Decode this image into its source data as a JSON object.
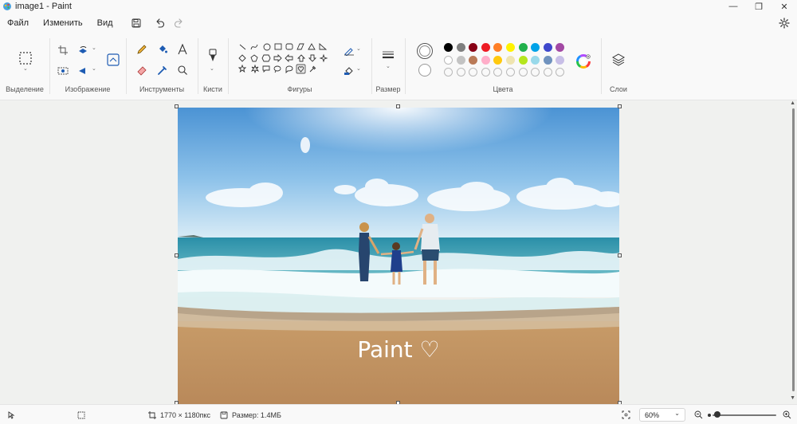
{
  "window": {
    "title": "image1 - Paint",
    "minimize": "—",
    "maximize": "❐",
    "close": "✕"
  },
  "menu": {
    "items": [
      "Файл",
      "Изменить",
      "Вид"
    ]
  },
  "ribbon": {
    "groups": {
      "selection": "Выделение",
      "image": "Изображение",
      "tools": "Инструменты",
      "brushes": "Кисти",
      "shapes": "Фигуры",
      "size": "Размер",
      "colors": "Цвета",
      "layers": "Слои"
    },
    "palette_row1": [
      "#000000",
      "#7f7f7f",
      "#880015",
      "#ed1c24",
      "#ff7f27",
      "#fff200",
      "#22b14c",
      "#00a2e8",
      "#3f48cc",
      "#a349a4"
    ],
    "palette_row2": [
      "#ffffff",
      "#c3c3c3",
      "#b97a57",
      "#ffaec9",
      "#ffc90e",
      "#efe4b0",
      "#b5e61d",
      "#99d9ea",
      "#7092be",
      "#c8bfe7"
    ],
    "palette_row3_empty": 10
  },
  "canvas": {
    "overlay_text": "Paint ♡",
    "accent": "#0067c0"
  },
  "status": {
    "dimensions": "1770 × 1180пкс",
    "size": "Размер: 1.4МБ",
    "zoom": "60%"
  }
}
